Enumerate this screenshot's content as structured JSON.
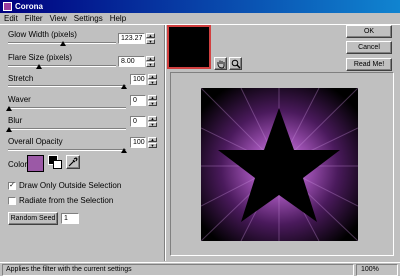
{
  "window": {
    "title": "Corona"
  },
  "menu": [
    "Edit",
    "Filter",
    "View",
    "Settings",
    "Help"
  ],
  "controls": {
    "glow_width": {
      "label": "Glow Width (pixels)",
      "value": "123.27"
    },
    "flare_size": {
      "label": "Flare Size (pixels)",
      "value": "8.00"
    },
    "stretch": {
      "label": "Stretch",
      "value": "100"
    },
    "waver": {
      "label": "Waver",
      "value": "0"
    },
    "blur": {
      "label": "Blur",
      "value": "0"
    },
    "opacity": {
      "label": "Overall Opacity",
      "value": "100"
    }
  },
  "color": {
    "label": "Color",
    "swatch": "#9b59a6"
  },
  "checkboxes": {
    "draw_outside": {
      "label": "Draw Only Outside Selection",
      "checked": true
    },
    "radiate": {
      "label": "Radiate from the Selection",
      "checked": false
    }
  },
  "random_seed": {
    "label": "Random Seed",
    "value": "1"
  },
  "buttons": {
    "ok": "OK",
    "cancel": "Cancel",
    "readme": "Read Me!"
  },
  "status": {
    "text": "Applies the filter with the current settings",
    "zoom": "100%"
  },
  "icons": [
    "hand-icon",
    "magnifier-icon",
    "eyedropper-icon"
  ]
}
